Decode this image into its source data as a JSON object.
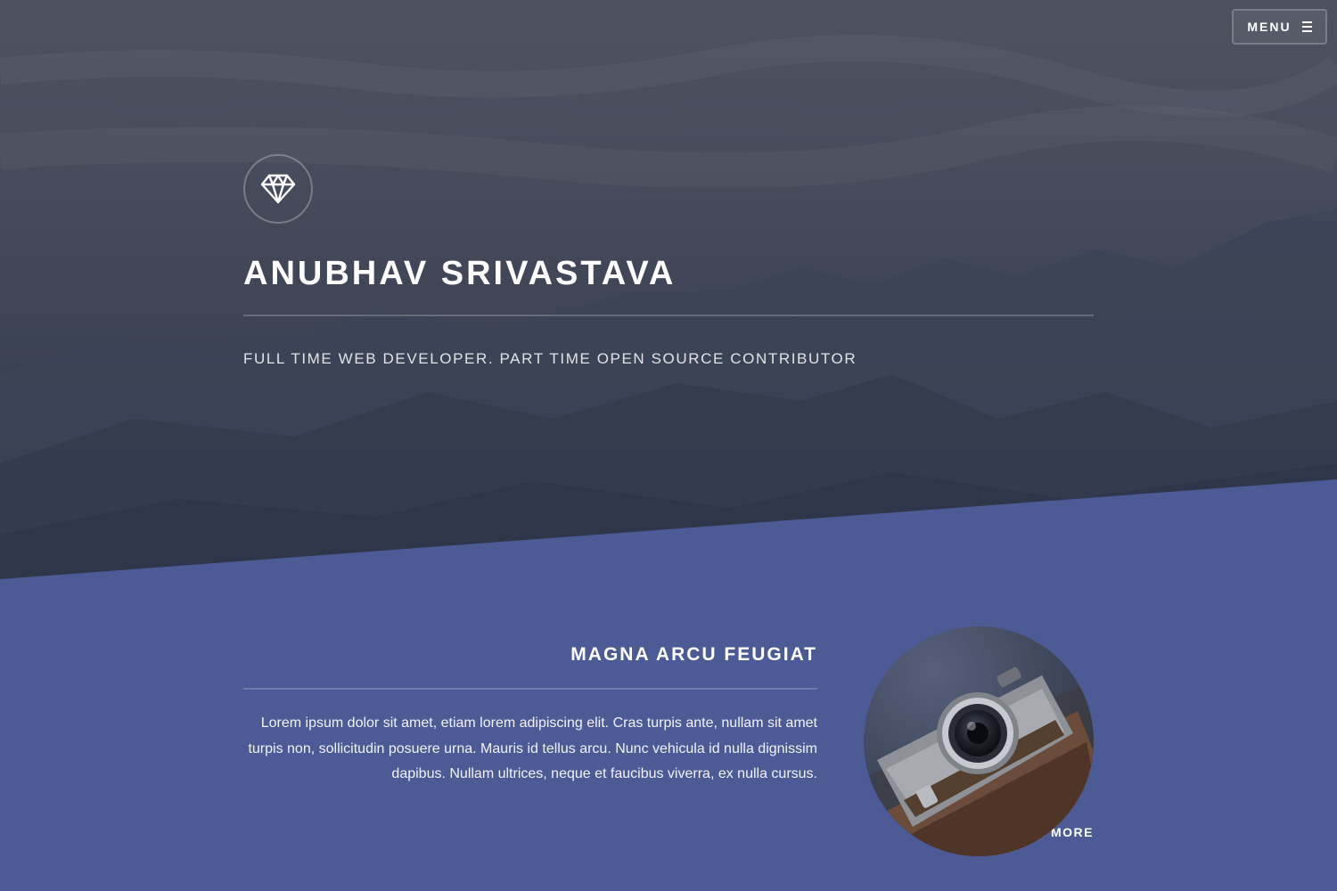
{
  "header": {
    "menu_label": "MENU",
    "menu_icon": "hamburger-icon"
  },
  "banner": {
    "logo_icon": "diamond-icon",
    "title": "ANUBHAV SRIVASTAVA",
    "tagline": "FULL TIME WEB DEVELOPER. PART TIME OPEN SOURCE CONTRIBUTOR"
  },
  "feature": {
    "heading": "MAGNA ARCU FEUGIAT",
    "body": "Lorem ipsum dolor sit amet, etiam lorem adipiscing elit. Cras turpis ante, nullam sit amet turpis non, sollicitudin posuere urna. Mauris id tellus arcu. Nunc vehicula id nulla dignissim dapibus. Nullam ultrices, neque et faucibus viverra, ex nulla cursus.",
    "learn_more_label": "LEARN MORE",
    "learn_more_icon": "chevron-right-icon",
    "image_subject": "camera-photo"
  },
  "colors": {
    "hero_overlay": "#474c5c",
    "section_background": "#4c5b96",
    "text": "#ffffff"
  }
}
